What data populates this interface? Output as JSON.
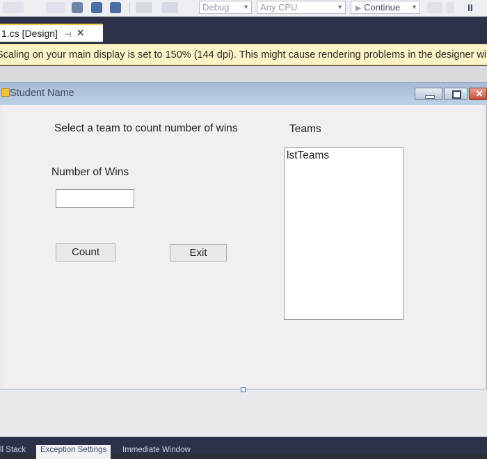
{
  "toolbar": {
    "config_combo": "Debug",
    "platform_combo": "Any CPU",
    "continue_label": "Continue",
    "pause_glyph": "II"
  },
  "document_tab": {
    "label": "1.cs [Design]",
    "pin_glyph": "⊣",
    "close_glyph": "×"
  },
  "infobar": {
    "message": "Scaling on your main display is set to 150% (144 dpi). This might cause rendering problems in the designer window"
  },
  "form": {
    "title": "Student Name",
    "prompt_label": "Select a team to count number of wins",
    "teams_label": "Teams",
    "wins_label": "Number of Wins",
    "wins_value": "",
    "list_name": "lstTeams",
    "count_button": "Count",
    "exit_button": "Exit"
  },
  "bottom_tabs": [
    "ll Stack",
    "Exception Settings",
    "Immediate Window"
  ]
}
